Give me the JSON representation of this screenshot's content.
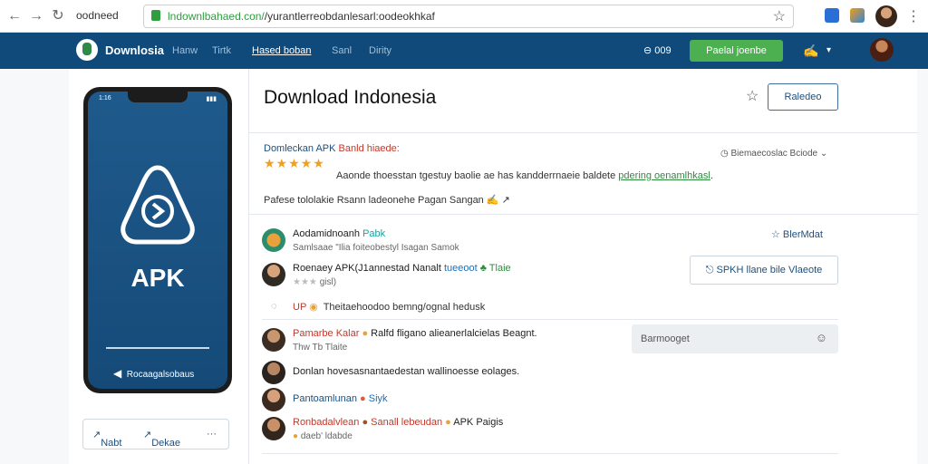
{
  "browser": {
    "profile_label": "oodneed",
    "url_prefix": "lndownlbahaed.con/",
    "url_rest": "/yurantlerreobdanlesarl:oodeokhkaf"
  },
  "header": {
    "brand": "Downlosia",
    "menu": [
      "Hanw",
      "Tirtk",
      "Hased boban",
      "Sanl",
      "Dirity"
    ],
    "stat": "⊖ 009",
    "cta": "Paelal joenbe"
  },
  "phone": {
    "time": "1:16",
    "apk_label": "APK",
    "footer_label": "Rocaagalsobaus"
  },
  "share": {
    "left": "Nabt",
    "right": "Dekae"
  },
  "main": {
    "title": "Download Indonesia",
    "bookmark_btn": "Raledeo",
    "section_title_a": "Domleckan APK",
    "section_title_b": "Banld hiaede:",
    "rating_stars": "★★★★★",
    "description_a": "Aaonde thoesstan tgestuy baolie ae has kandderrnaeie baldete",
    "description_link": "pdering oenamlhkasl",
    "subline": "Pafese tololakie Rsann ladeonehe Pagan Sangan",
    "sort_label": "Biemaecoslac Bciode"
  },
  "comments": [
    {
      "name": "Aodamidnoanh",
      "tag": "Pabk",
      "sub": "Samlsaae \"Ilia foiteobestyl Isagan Samok"
    },
    {
      "name": "Roenaey APK(J1annestad Nanalt",
      "tag": "tueeoot",
      "tag2": "Tlaie",
      "sub": "gisl)"
    },
    {
      "name": "UP",
      "tag": "",
      "sub_inline": "Theitaehoodoo bemng/ognal hedusk"
    },
    {
      "name": "Pamarbe Kalar",
      "tag": "Ralfd fligano alieanerlalcielas Beagnt.",
      "sub": "Thw Tb Tlaite"
    },
    {
      "name": "Donlan",
      "tag": "hovesasnantaedestan wallinoesse eolages.",
      "sub": ""
    },
    {
      "name": "Pantoamlunan",
      "tag": "Siyk",
      "sub": ""
    },
    {
      "name": "Ronbadalvlean",
      "tag": "Sanall lebeudan",
      "tag2": "APK Paigis",
      "sub": "daeb' ldabde"
    }
  ],
  "sidebar": {
    "follow": "BlerMdat",
    "action_btn": "SPKH llane bile Vlaeote",
    "search_placeholder": "Barmooget"
  }
}
